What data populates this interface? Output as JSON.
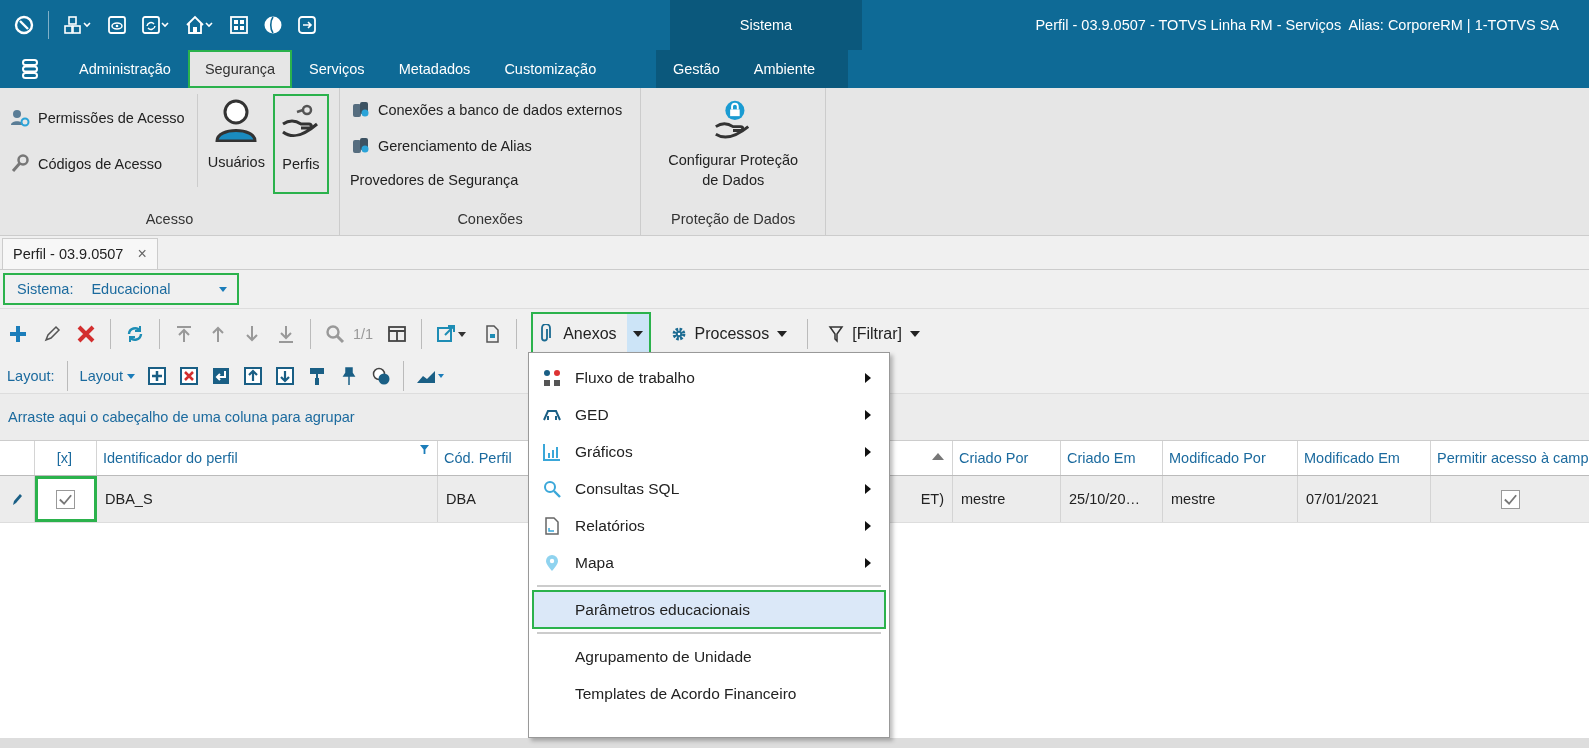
{
  "top_bar": {
    "title": "Perfil - 03.9.0507 - TOTVS Linha RM - Serviços  Alias: CorporeRM | 1-TOTVS SA"
  },
  "tabs": [
    {
      "label": "Administração",
      "selected": false,
      "highlighted": false
    },
    {
      "label": "Segurança",
      "selected": true,
      "highlighted": true
    },
    {
      "label": "Serviços",
      "selected": false,
      "highlighted": false
    },
    {
      "label": "Metadados",
      "selected": false,
      "highlighted": false
    },
    {
      "label": "Customização",
      "selected": false,
      "highlighted": false
    }
  ],
  "context_group": {
    "label": "Sistema",
    "tabs": [
      {
        "label": "Gestão",
        "selected": false
      },
      {
        "label": "Ambiente",
        "selected": false
      }
    ]
  },
  "ribbon": {
    "groups": [
      {
        "label": "Acesso",
        "items": [
          {
            "kind": "small",
            "label": "Permissões de Acesso",
            "highlighted": false
          },
          {
            "kind": "small",
            "label": "Códigos de Acesso",
            "highlighted": false
          },
          {
            "kind": "large",
            "label": "Usuários",
            "highlighted": false
          },
          {
            "kind": "large",
            "label": "Perfis",
            "highlighted": true
          }
        ]
      },
      {
        "label": "Conexões",
        "items": [
          {
            "kind": "small",
            "label": "Conexões a banco de dados externos",
            "highlighted": false
          },
          {
            "kind": "small",
            "label": "Gerenciamento de Alias",
            "highlighted": false
          },
          {
            "kind": "text",
            "label": "Provedores de Segurança",
            "highlighted": false
          }
        ]
      },
      {
        "label": "Proteção de Dados",
        "items": [
          {
            "kind": "large",
            "label": "Configurar Proteção de Dados",
            "highlighted": false
          }
        ]
      }
    ]
  },
  "document_tab": {
    "label": "Perfil - 03.9.0507",
    "close": "×"
  },
  "system_selector": {
    "label": "Sistema:",
    "value": "Educacional",
    "highlighted": true
  },
  "toolbar": {
    "pager": "1/1",
    "buttons": [
      {
        "kind": "split",
        "label": "Anexos",
        "highlighted": true
      },
      {
        "kind": "dropdown",
        "label": "Processos",
        "highlighted": false
      },
      {
        "kind": "filter",
        "label": "[Filtrar]",
        "highlighted": false
      }
    ]
  },
  "layout_bar": {
    "label": "Layout:",
    "button": "Layout"
  },
  "group_hint": "Arraste aqui o cabeçalho de uma coluna para agrupar",
  "grid": {
    "columns": [
      {
        "label": "[x]"
      },
      {
        "label": "Identificador do perfil",
        "filtered": true
      },
      {
        "label": "Cód. Perfil"
      },
      {
        "sorted": true
      },
      {
        "label": "Criado Por"
      },
      {
        "label": "Criado Em"
      },
      {
        "label": "Modificado Por"
      },
      {
        "label": "Modificado Em"
      },
      {
        "label": "Permitir acesso à camp"
      }
    ],
    "rows": [
      {
        "editing": true,
        "selected": true,
        "cells": [
          {
            "kind": "check",
            "checked": true,
            "highlighted": true
          },
          {
            "kind": "text",
            "text": "DBA_S"
          },
          {
            "kind": "text",
            "text": "DBA"
          },
          {
            "kind": "text",
            "text": "ET)"
          },
          {
            "kind": "text",
            "text": "mestre"
          },
          {
            "kind": "text",
            "text": "25/10/20…"
          },
          {
            "kind": "text",
            "text": "mestre"
          },
          {
            "kind": "text",
            "text": "07/01/2021"
          },
          {
            "kind": "check",
            "checked": true,
            "highlighted": false
          }
        ]
      }
    ]
  },
  "context_menu": {
    "items": [
      {
        "kind": "submenu",
        "label": "Fluxo de trabalho",
        "selected": false,
        "highlighted": false
      },
      {
        "kind": "submenu",
        "label": "GED",
        "selected": false,
        "highlighted": false
      },
      {
        "kind": "submenu",
        "label": "Gráficos",
        "selected": false,
        "highlighted": false
      },
      {
        "kind": "submenu",
        "label": "Consultas SQL",
        "selected": false,
        "highlighted": false
      },
      {
        "kind": "submenu",
        "label": "Relatórios",
        "selected": false,
        "highlighted": false
      },
      {
        "kind": "submenu",
        "label": "Mapa",
        "selected": false,
        "highlighted": false
      },
      {
        "kind": "separator"
      },
      {
        "kind": "item",
        "label": "Parâmetros educacionais",
        "selected": true,
        "highlighted": true
      },
      {
        "kind": "separator"
      },
      {
        "kind": "item",
        "label": "Agrupamento de Unidade",
        "selected": false,
        "highlighted": false
      },
      {
        "kind": "item",
        "label": "Templates de Acordo Financeiro",
        "selected": false,
        "highlighted": false
      }
    ]
  }
}
